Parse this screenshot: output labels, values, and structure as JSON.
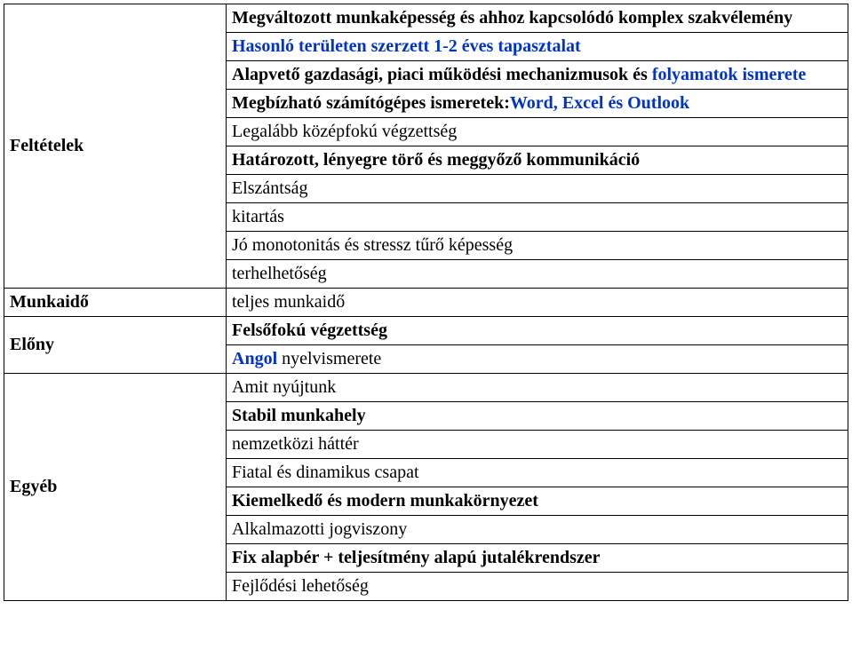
{
  "labels": {
    "feltetelek": "Feltételek",
    "munkaido": "Munkaidő",
    "elony": "Előny",
    "egyeb": "Egyéb"
  },
  "feltetelek": {
    "r1": "Megváltozott munkaképesség és ahhoz kapcsolódó komplex szakvélemény",
    "r2": "Hasonló területen szerzett 1-2 éves tapasztalat",
    "r3_a": "Alapvető gazdasági, piaci működési mechanizmusok és ",
    "r3_b": "folyamatok ismerete",
    "r4_a": "Megbízható számítógépes ismeretek:",
    "r4_b": "Word, Excel és Outlook",
    "r5": "Legalább középfokú végzettség",
    "r6": "Határozott, lényegre törő és meggyőző kommunikáció",
    "r7": "Elszántság",
    "r8": "kitartás",
    "r9": "Jó monotonitás és stressz tűrő képesség",
    "r10": "terhelhetőség"
  },
  "munkaido": {
    "r1": "teljes munkaidő"
  },
  "elony": {
    "r1": "Felsőfokú végzettség",
    "r2_a": "Angol",
    "r2_b": "  nyelvismerete"
  },
  "egyeb": {
    "r1": "Amit nyújtunk",
    "r2": "Stabil munkahely",
    "r3": "nemzetközi háttér",
    "r4": "Fiatal és dinamikus csapat",
    "r5": "Kiemelkedő és modern munkakörnyezet",
    "r6": "Alkalmazotti jogviszony",
    "r7": "Fix alapbér + teljesítmény alapú jutalékrendszer",
    "r8": "Fejlődési lehetőség"
  }
}
